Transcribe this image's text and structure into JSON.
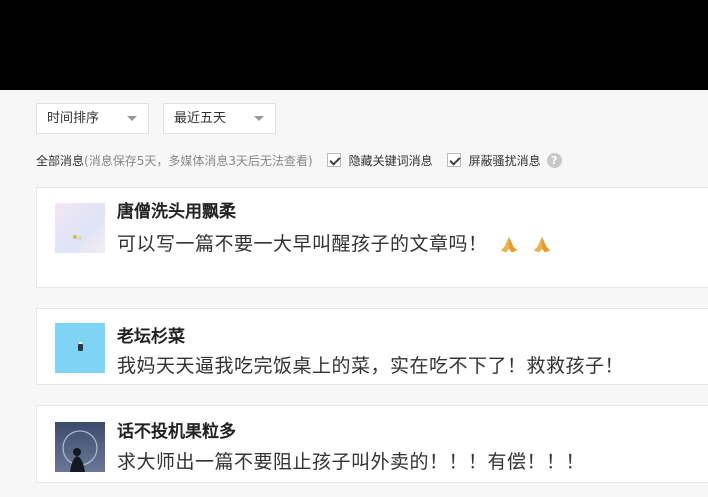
{
  "filters": {
    "sort": {
      "value": "时间排序"
    },
    "range": {
      "value": "最近五天"
    }
  },
  "toolbar": {
    "all_messages": "全部消息",
    "note": "(消息保存5天，多媒体消息3天后无法查看)",
    "hide_keywords": {
      "label": "隐藏关键词消息",
      "checked": true
    },
    "block_harass": {
      "label": "屏蔽骚扰消息",
      "checked": true
    },
    "help_icon": "?"
  },
  "messages": [
    {
      "name": "唐僧洗头用飘柔",
      "text": "可以写一篇不要一大早叫醒孩子的文章吗！",
      "emojis": [
        "pray-hands",
        "pray-hands"
      ]
    },
    {
      "name": "老坛杉菜",
      "text": "我妈天天逼我吃完饭桌上的菜，实在吃不下了！救救孩子！"
    },
    {
      "name": "话不投机果粒多",
      "text": "求大师出一篇不要阻止孩子叫外卖的！！！有偿！！！"
    }
  ],
  "colors": {
    "top_bar": "#000000",
    "panel_bg": "#f7f7f7",
    "card_bg": "#ffffff",
    "avatar_1": "#e9d8f0",
    "avatar_2": "#7fd3f4",
    "avatar_3": "#4a5a7a",
    "emoji": "#f2b04a"
  }
}
